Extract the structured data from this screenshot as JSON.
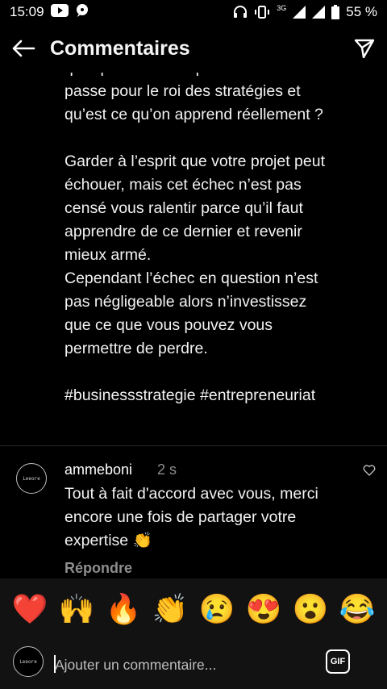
{
  "status_bar": {
    "time": "15:09",
    "network": "3G",
    "battery_percent": "55 %",
    "icons": [
      "youtube-icon",
      "chat-notification-icon",
      "headphones-icon",
      "vibrate-icon",
      "signal-icon",
      "battery-icon"
    ]
  },
  "header": {
    "title": "Commentaires",
    "back_icon": "arrow-left-icon",
    "share_icon": "paper-plane-icon"
  },
  "post": {
    "text": "que quand on n’a que des succès on\npasse pour le roi des stratégies et\nqu’est ce qu’on apprend réellement ?\n\nGarder à l’esprit que votre projet peut\néchouer, mais cet échec n’est pas\ncensé vous ralentir parce qu’il faut\napprendre de ce dernier et revenir\nmieux armé.\nCependant l’échec en question n’est\npas négligeable alors n’investissez\nque ce que vous pouvez vous\npermettre de perdre.\n\n#businessstrategie #entrepreneuriat"
  },
  "comment": {
    "avatar_label": "Leeore",
    "username": "ammeboni",
    "time": "2 s",
    "text": "Tout à fait d'accord avec vous, merci encore une fois de partager votre expertise 👏",
    "reply_label": "Répondre",
    "like_icon": "heart-outline-icon"
  },
  "emoji_bar": [
    "❤️",
    "🙌",
    "🔥",
    "👏",
    "😢",
    "😍",
    "😮",
    "😂"
  ],
  "composer": {
    "avatar_label": "Leeore",
    "placeholder": "Ajouter un commentaire...",
    "gif_label": "GIF"
  }
}
